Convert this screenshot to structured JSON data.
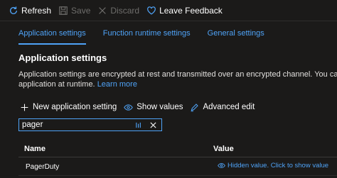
{
  "toolbar": {
    "refresh_label": "Refresh",
    "save_label": "Save",
    "discard_label": "Discard",
    "feedback_label": "Leave Feedback"
  },
  "tabs": [
    {
      "label": "Application settings",
      "active": true
    },
    {
      "label": "Function runtime settings",
      "active": false
    },
    {
      "label": "General settings",
      "active": false
    }
  ],
  "section": {
    "title": "Application settings",
    "description_line1": "Application settings are encrypted at rest and transmitted over an encrypted channel. You can choose to dis",
    "description_line2": "application at runtime.",
    "learn_more": "Learn more"
  },
  "actions": {
    "new_setting": "New application setting",
    "show_values": "Show values",
    "advanced_edit": "Advanced edit"
  },
  "filter": {
    "value": "pager"
  },
  "grid": {
    "columns": [
      "Name",
      "Value"
    ],
    "rows": [
      {
        "name": "PagerDuty",
        "value": "Hidden value. Click to show value"
      }
    ]
  },
  "colors": {
    "accent": "#4fa3f7",
    "background": "#1b1a19",
    "disabled": "#6e6d6b"
  }
}
